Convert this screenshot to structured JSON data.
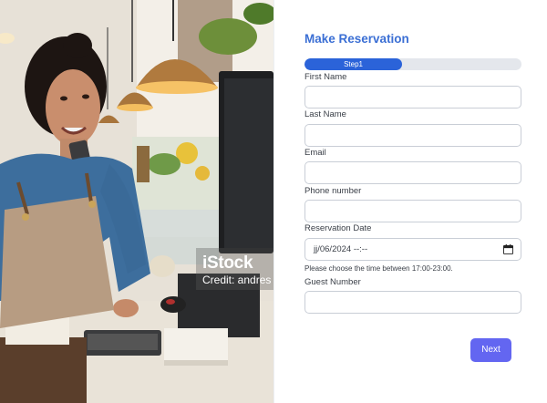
{
  "photo": {
    "watermark_logo": "iStock",
    "watermark_credit": "Credit: andres"
  },
  "form": {
    "title": "Make Reservation",
    "progress": {
      "label": "Step1",
      "fraction": 0.45,
      "color": "#2b63d9"
    },
    "fields": {
      "first_name": {
        "label": "First Name",
        "value": ""
      },
      "last_name": {
        "label": "Last Name",
        "value": ""
      },
      "email": {
        "label": "Email",
        "value": ""
      },
      "phone": {
        "label": "Phone number",
        "value": ""
      },
      "reservation_date": {
        "label": "Reservation Date",
        "value": "jj/06/2024 --:--",
        "icon": "calendar-icon"
      },
      "guest_number": {
        "label": "Guest Number",
        "value": ""
      }
    },
    "time_hint": "Please choose the time between 17:00-23:00.",
    "next_label": "Next",
    "colors": {
      "title": "#3b6fd4",
      "button": "#6366f1"
    }
  }
}
